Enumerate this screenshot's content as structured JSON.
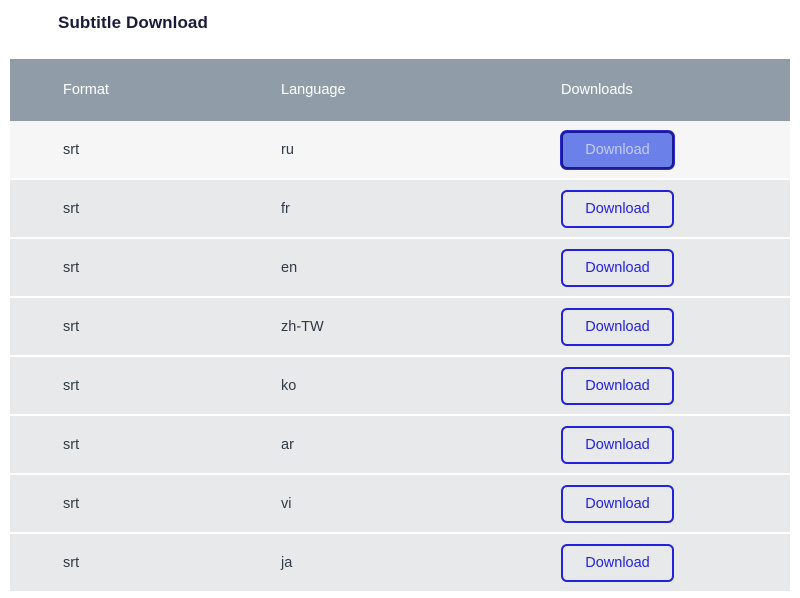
{
  "page": {
    "title": "Subtitle Download",
    "background_color": "#ffffff"
  },
  "colors": {
    "header_background": "#909DA8",
    "header_text": "#FFFFFF",
    "row_default": "#E8E9EA",
    "row_active": "#F6F6F7",
    "row_separator": "#FFFFFF",
    "button_border": "#2222DD",
    "button_text": "#2222DD",
    "button_active_fill": "#6B80E8",
    "button_active_text": "#C3CCF4",
    "button_active_border": "#1B1B8F",
    "title_text": "#1A1A3A",
    "cell_text": "#303A45"
  },
  "table": {
    "columns": [
      {
        "key": "format",
        "label": "Format"
      },
      {
        "key": "language",
        "label": "Language"
      },
      {
        "key": "download",
        "label": "Downloads"
      }
    ],
    "button_label": "Download",
    "rows": [
      {
        "format": "srt",
        "language": "ru",
        "button_label": "Download",
        "state": "active"
      },
      {
        "format": "srt",
        "language": "fr",
        "button_label": "Download",
        "state": "default"
      },
      {
        "format": "srt",
        "language": "en",
        "button_label": "Download",
        "state": "default"
      },
      {
        "format": "srt",
        "language": "zh-TW",
        "button_label": "Download",
        "state": "default"
      },
      {
        "format": "srt",
        "language": "ko",
        "button_label": "Download",
        "state": "default"
      },
      {
        "format": "srt",
        "language": "ar",
        "button_label": "Download",
        "state": "default"
      },
      {
        "format": "srt",
        "language": "vi",
        "button_label": "Download",
        "state": "default"
      },
      {
        "format": "srt",
        "language": "ja",
        "button_label": "Download",
        "state": "default"
      }
    ]
  }
}
